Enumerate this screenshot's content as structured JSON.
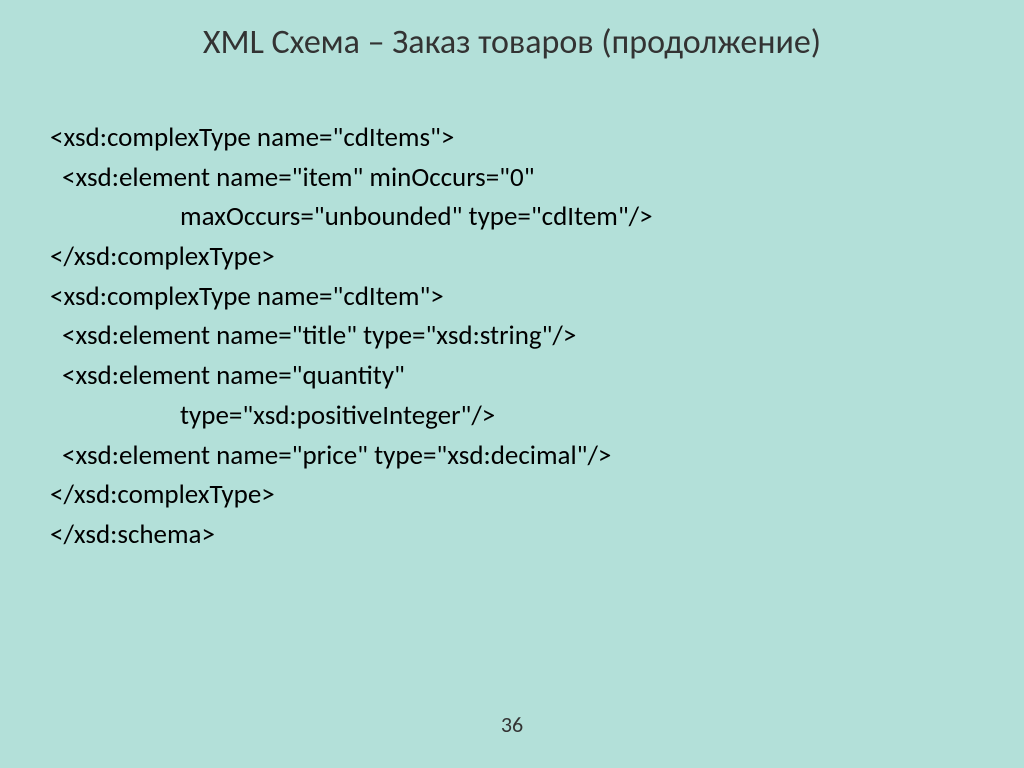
{
  "title": "XML Схема – Заказ товаров (продолжение)",
  "code": {
    "line1": "<xsd:complexType name=\"cdItems\">",
    "line2": "<xsd:element name=\"item\" minOccurs=\"0\"",
    "line3": "maxOccurs=\"unbounded\" type=\"cdItem\"/>",
    "line4": "</xsd:complexType>",
    "line5": "<xsd:complexType name=\"cdItem\">",
    "line6": "<xsd:element name=\"title\" type=\"xsd:string\"/>",
    "line7": "<xsd:element name=\"quantity\"",
    "line8": "type=\"xsd:positiveInteger\"/>",
    "line9": "<xsd:element name=\"price\" type=\"xsd:decimal\"/>",
    "line10": "</xsd:complexType>",
    "line11": "</xsd:schema>"
  },
  "pageNumber": "36"
}
